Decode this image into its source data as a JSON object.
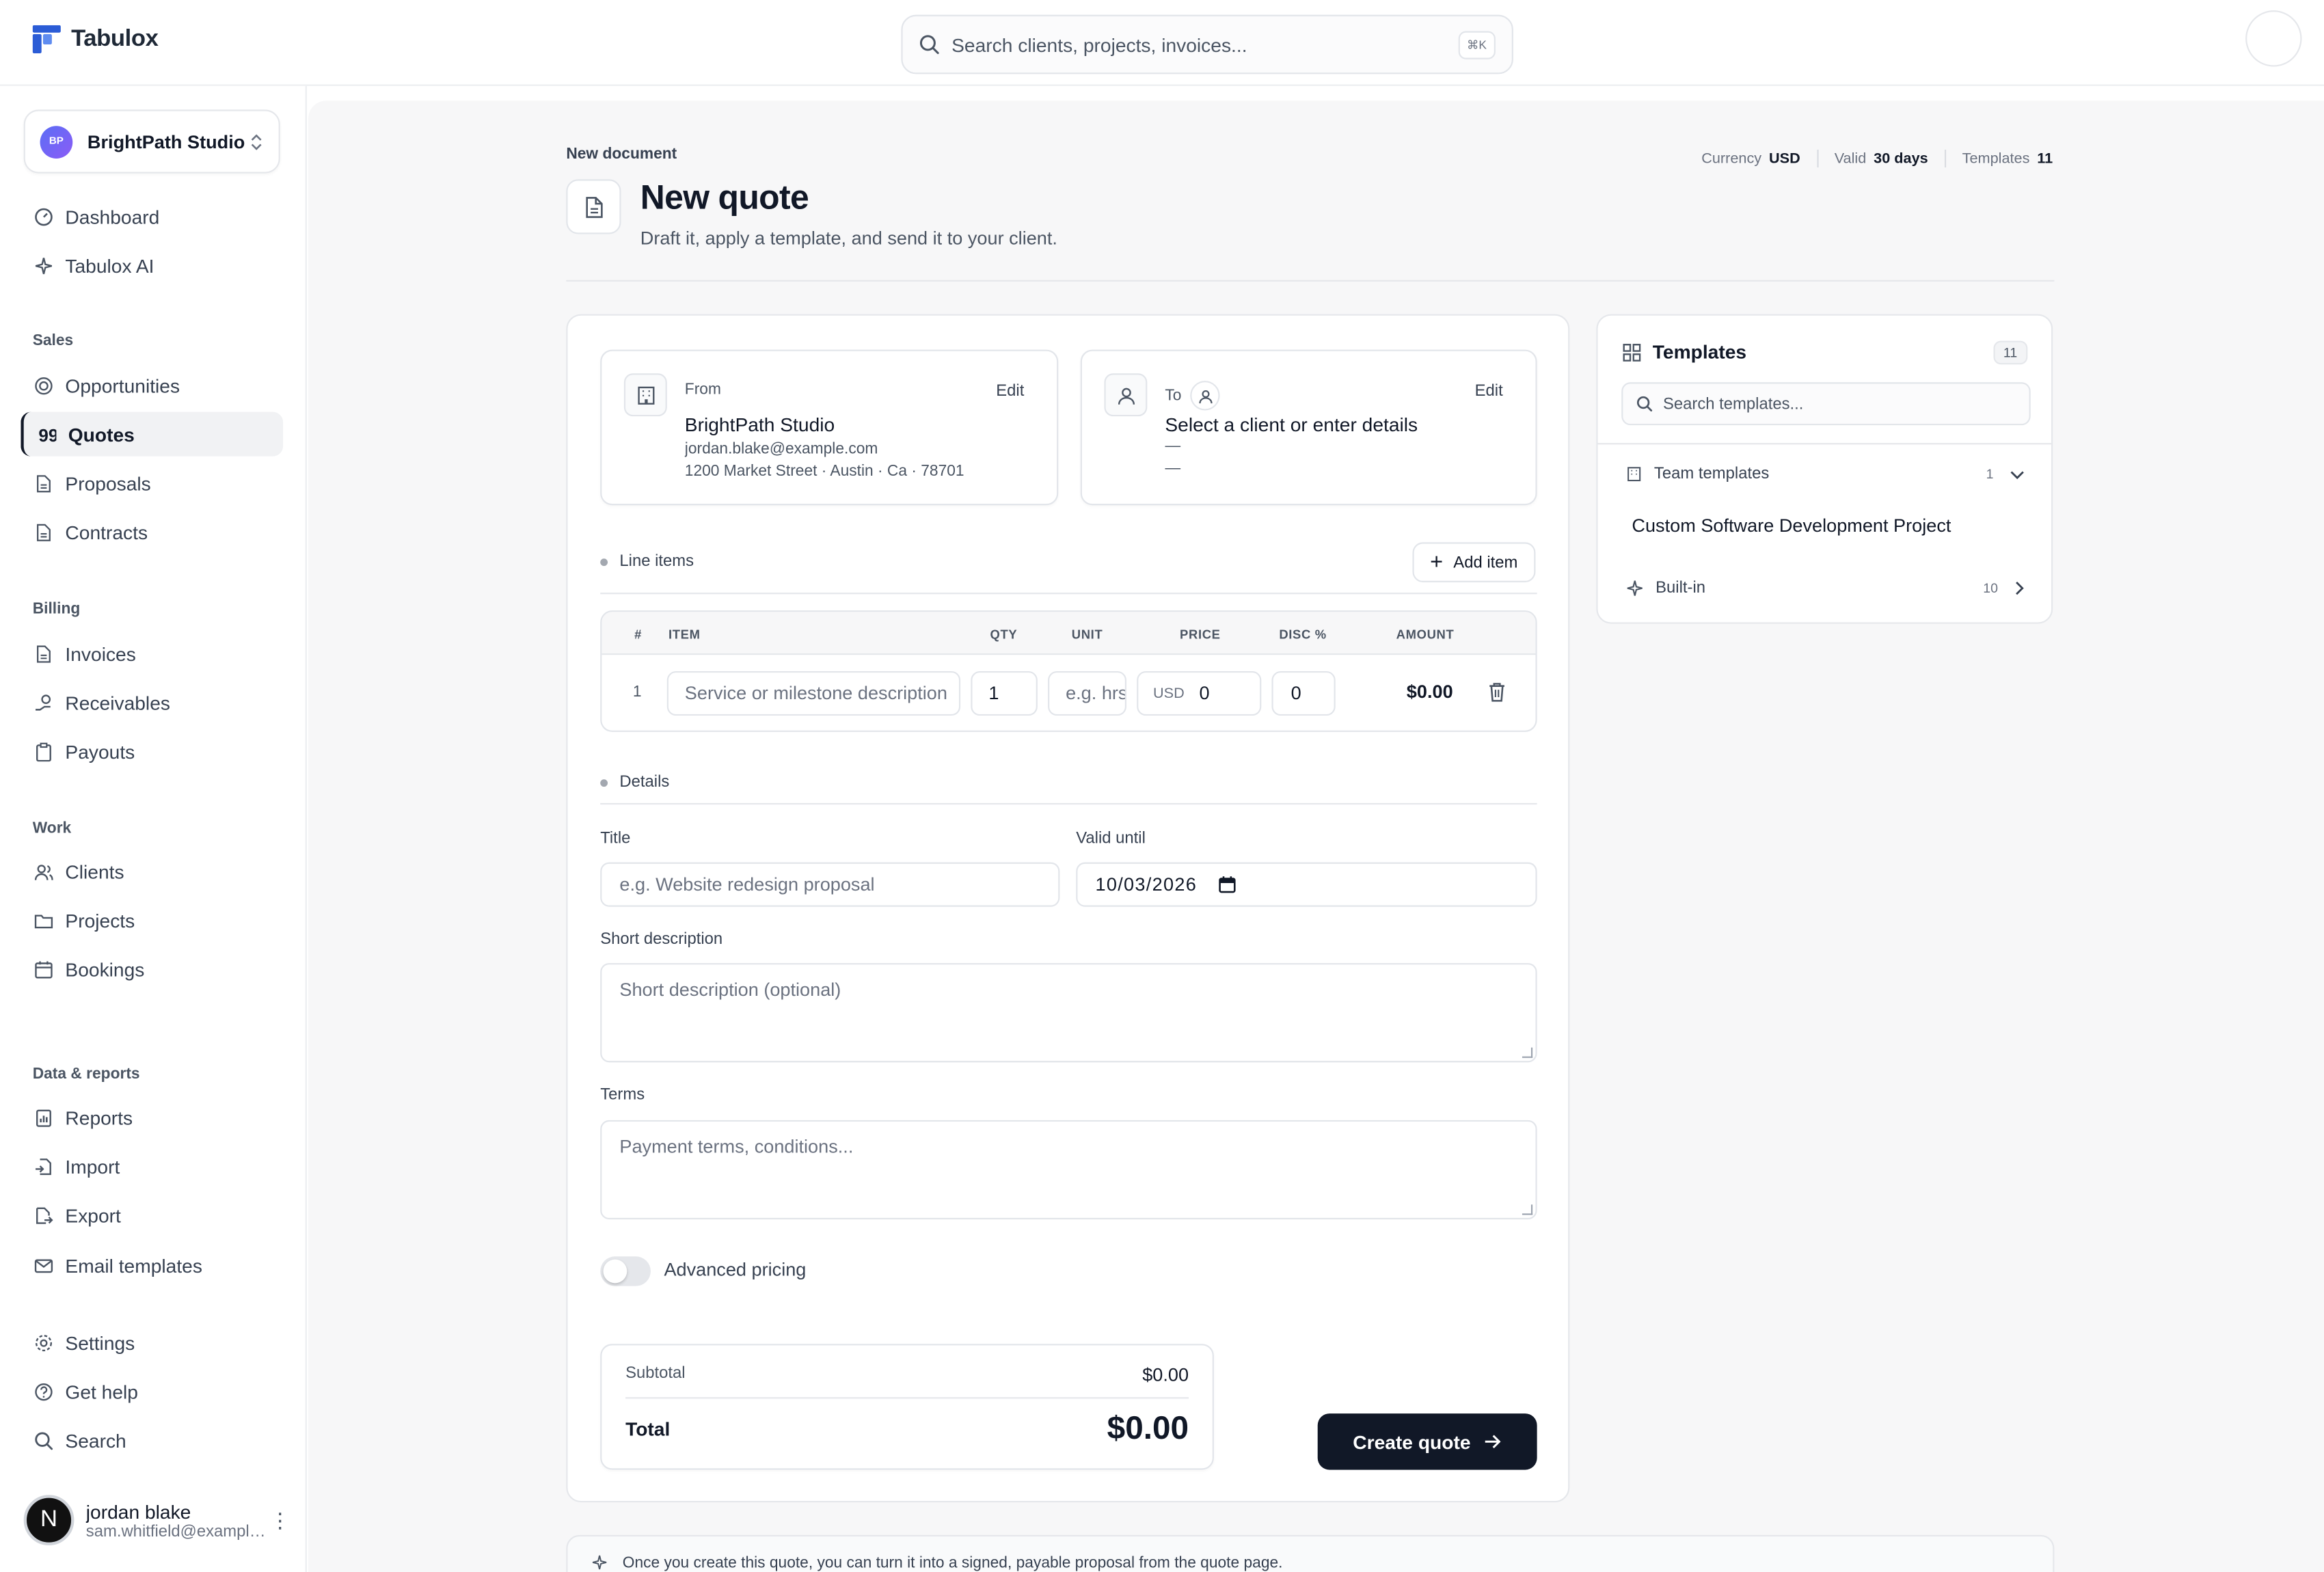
{
  "app": {
    "name": "Tabulox"
  },
  "search": {
    "placeholder": "Search clients, projects, invoices...",
    "shortcut": "⌘K"
  },
  "workspace": {
    "initials": "BP",
    "name": "BrightPath Studio"
  },
  "sidebar": {
    "top_items": [
      {
        "label": "Dashboard",
        "icon": "dashboard-icon"
      },
      {
        "label": "Tabulox AI",
        "icon": "sparkles-icon"
      }
    ],
    "sections": [
      {
        "title": "Sales",
        "items": [
          {
            "label": "Opportunities",
            "icon": "target-icon"
          },
          {
            "label": "Quotes",
            "icon": "quote-icon",
            "active": true
          },
          {
            "label": "Proposals",
            "icon": "document-icon"
          },
          {
            "label": "Contracts",
            "icon": "document-icon"
          }
        ]
      },
      {
        "title": "Billing",
        "items": [
          {
            "label": "Invoices",
            "icon": "document-icon"
          },
          {
            "label": "Receivables",
            "icon": "hand-coins-icon"
          },
          {
            "label": "Payouts",
            "icon": "clipboard-icon"
          }
        ]
      },
      {
        "title": "Work",
        "items": [
          {
            "label": "Clients",
            "icon": "users-icon"
          },
          {
            "label": "Projects",
            "icon": "folder-icon"
          },
          {
            "label": "Bookings",
            "icon": "calendar-icon"
          }
        ]
      },
      {
        "title": "Data & reports",
        "items": [
          {
            "label": "Reports",
            "icon": "report-icon"
          },
          {
            "label": "Import",
            "icon": "import-icon"
          },
          {
            "label": "Export",
            "icon": "export-icon"
          },
          {
            "label": "Email templates",
            "icon": "mail-icon"
          }
        ]
      }
    ],
    "bottom_items": [
      {
        "label": "Settings",
        "icon": "gear-icon"
      },
      {
        "label": "Get help",
        "icon": "help-icon"
      },
      {
        "label": "Search",
        "icon": "search-icon"
      }
    ],
    "user": {
      "initial": "N",
      "name": "jordan blake",
      "email": "sam.whitfield@example.com"
    }
  },
  "page": {
    "breadcrumb": "New document",
    "title": "New quote",
    "subtitle": "Draft it, apply a template, and send it to your client.",
    "meta": [
      {
        "label": "Currency",
        "value": "USD"
      },
      {
        "label": "Valid",
        "value": "30 days"
      },
      {
        "label": "Templates",
        "value": "11"
      }
    ]
  },
  "from": {
    "label": "From",
    "edit": "Edit",
    "name": "BrightPath Studio",
    "email": "jordan.blake@example.com",
    "address": "1200 Market Street · Austin · Ca · 78701"
  },
  "to": {
    "label": "To",
    "edit": "Edit",
    "name": "Select a client or enter details",
    "line2": "—",
    "line3": "—"
  },
  "line_items": {
    "title": "Line items",
    "add_label": "Add item",
    "columns": [
      "#",
      "ITEM",
      "QTY",
      "UNIT",
      "PRICE",
      "DISC %",
      "AMOUNT"
    ],
    "rows": [
      {
        "num": "1",
        "item_placeholder": "Service or milestone description",
        "qty": "1",
        "unit_placeholder": "e.g. hrs",
        "currency": "USD",
        "price": "0",
        "disc": "0",
        "amount": "$0.00"
      }
    ]
  },
  "details": {
    "title": "Details",
    "title_label": "Title",
    "title_placeholder": "e.g. Website redesign proposal",
    "valid_label": "Valid until",
    "valid_value": "10/03/2026",
    "desc_label": "Short description",
    "desc_placeholder": "Short description (optional)",
    "terms_label": "Terms",
    "terms_placeholder": "Payment terms, conditions..."
  },
  "advanced": {
    "label": "Advanced pricing",
    "enabled": false
  },
  "totals": {
    "subtotal_label": "Subtotal",
    "subtotal": "$0.00",
    "total_label": "Total",
    "total": "$0.00"
  },
  "create_label": "Create quote",
  "templates": {
    "title": "Templates",
    "count": "11",
    "search_placeholder": "Search templates...",
    "groups": [
      {
        "label": "Team templates",
        "count": "1",
        "expanded": true,
        "items": [
          "Custom Software Development Project"
        ]
      },
      {
        "label": "Built-in",
        "count": "10",
        "expanded": false
      }
    ]
  },
  "notice": "Once you create this quote, you can turn it into a signed, payable proposal from the quote page."
}
